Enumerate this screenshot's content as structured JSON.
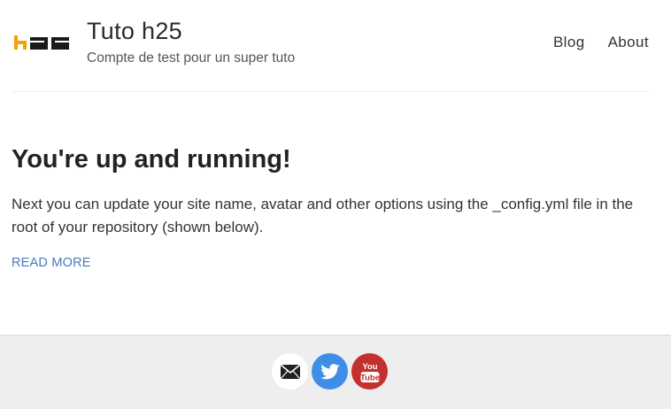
{
  "header": {
    "logo_text": "h25",
    "site_title": "Tuto h25",
    "site_description": "Compte de test pour un super tuto",
    "nav": [
      {
        "label": "Blog"
      },
      {
        "label": "About"
      }
    ]
  },
  "post": {
    "title": "You're up and running!",
    "excerpt": "Next you can update your site name, avatar and other options using the _config.yml file in the root of your repository (shown below).",
    "read_more_label": "READ MORE"
  },
  "footer": {
    "social": [
      {
        "icon": "email-icon",
        "color": "#ffffff"
      },
      {
        "icon": "twitter-icon",
        "color": "#3f8ee6"
      },
      {
        "icon": "youtube-icon",
        "color": "#c4302b",
        "text_top": "You",
        "text_bottom": "Tube"
      }
    ]
  },
  "colors": {
    "logo_accent": "#f5a200",
    "link": "#4a79b8",
    "footer_bg": "#eeeeee"
  }
}
